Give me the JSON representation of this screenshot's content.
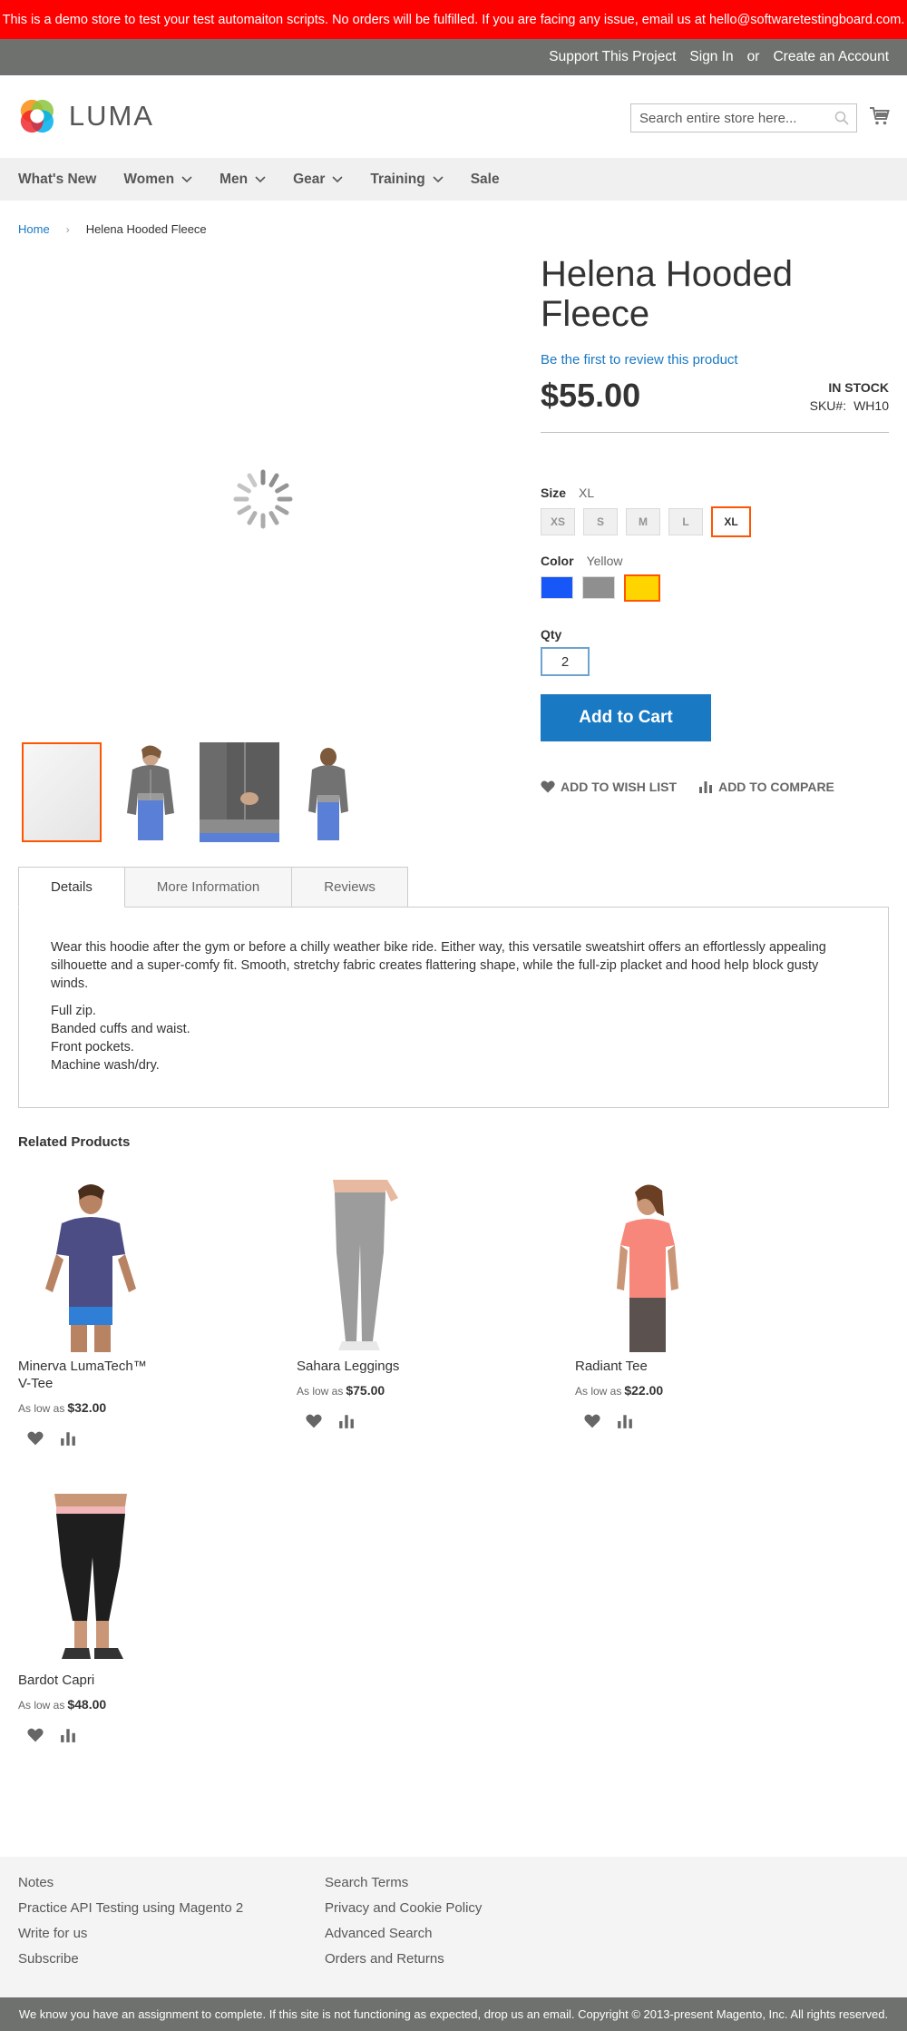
{
  "banner": {
    "text": "This is a demo store to test your test automaiton scripts. No orders will be fulfilled. If you are facing any issue, email us at hello@softwaretestingboard.com."
  },
  "topbar": {
    "support": "Support This Project",
    "sign_in": "Sign In",
    "or": "or",
    "create_account": "Create an Account"
  },
  "header": {
    "logo_text": "LUMA",
    "search_placeholder": "Search entire store here...",
    "icons": {
      "search": "search-icon",
      "cart": "cart-icon"
    }
  },
  "nav": {
    "items": [
      {
        "label": "What's New",
        "has_dropdown": false
      },
      {
        "label": "Women",
        "has_dropdown": true
      },
      {
        "label": "Men",
        "has_dropdown": true
      },
      {
        "label": "Gear",
        "has_dropdown": true
      },
      {
        "label": "Training",
        "has_dropdown": true
      },
      {
        "label": "Sale",
        "has_dropdown": false
      }
    ]
  },
  "breadcrumbs": {
    "home": "Home",
    "separator": "›",
    "current": "Helena Hooded Fleece"
  },
  "product": {
    "title": "Helena Hooded Fleece",
    "review_link": "Be the first to review this product",
    "price": "$55.00",
    "stock": "In stock",
    "sku_label": "SKU#:",
    "sku": "WH10",
    "size": {
      "label": "Size",
      "selected": "XL",
      "options": [
        "XS",
        "S",
        "M",
        "L",
        "XL"
      ]
    },
    "color": {
      "label": "Color",
      "selected": "Yellow",
      "options": [
        {
          "name": "Blue",
          "hex": "#1857f7"
        },
        {
          "name": "Gray",
          "hex": "#8f8f8f"
        },
        {
          "name": "Yellow",
          "hex": "#ffd500"
        }
      ]
    },
    "qty": {
      "label": "Qty",
      "value": "2"
    },
    "add_to_cart": "Add to Cart",
    "wishlist": "Add to Wish List",
    "compare": "Add to Compare"
  },
  "tabs": {
    "items": [
      "Details",
      "More Information",
      "Reviews"
    ],
    "active": "Details",
    "description": "Wear this hoodie after the gym or before a chilly weather bike ride. Either way, this versatile sweatshirt offers an effortlessly appealing silhouette and a super-comfy fit. Smooth, stretchy fabric creates flattering shape, while the full-zip placket and hood help block gusty winds.",
    "features": [
      "Full zip.",
      "Banded cuffs and waist.",
      "Front pockets.",
      "Machine wash/dry."
    ]
  },
  "related": {
    "title": "Related Products",
    "price_prefix": "As low as",
    "items": [
      {
        "name": "Minerva LumaTech™ V-Tee",
        "price": "$32.00"
      },
      {
        "name": "Sahara Leggings",
        "price": "$75.00"
      },
      {
        "name": "Radiant Tee",
        "price": "$22.00"
      },
      {
        "name": "Bardot Capri",
        "price": "$48.00"
      }
    ]
  },
  "footer": {
    "col1": [
      "Notes",
      "Practice API Testing using Magento 2",
      "Write for us",
      "Subscribe"
    ],
    "col2": [
      "Search Terms",
      "Privacy and Cookie Policy",
      "Advanced Search",
      "Orders and Returns"
    ],
    "copyright": "We know you have an assignment to complete. If this site is not functioning as expected, drop us an email. Copyright © 2013-present Magento, Inc. All rights reserved."
  },
  "colors": {
    "banner": "#ff0000",
    "topbar": "#6e716e",
    "accent_blue": "#1979c3",
    "selected_border": "#ff5501"
  }
}
